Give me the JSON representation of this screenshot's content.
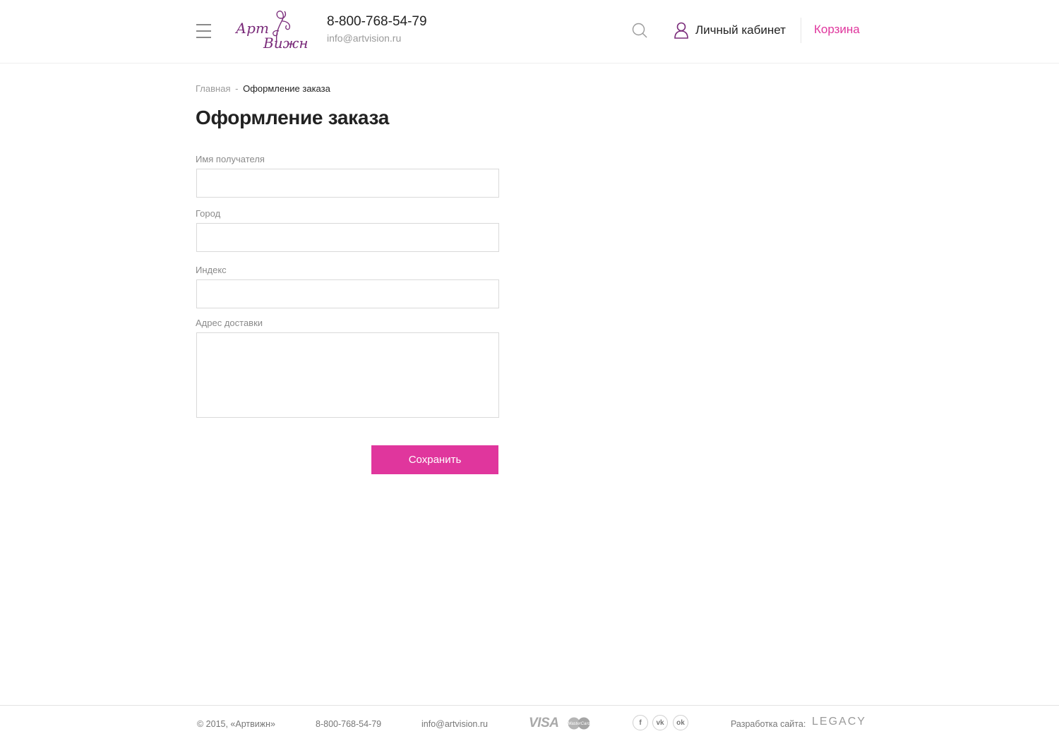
{
  "header": {
    "logo": {
      "line1": "Арт",
      "line2": "Вижн"
    },
    "phone": "8-800-768-54-79",
    "email": "info@artvision.ru",
    "cabinet_label": "Личный кабинет",
    "cart_label": "Корзина",
    "icons": {
      "menu": "hamburger-icon",
      "search": "search-icon",
      "user": "user-icon"
    }
  },
  "breadcrumb": {
    "home": "Главная",
    "separator": "-",
    "current": "Оформление заказа"
  },
  "page_title": "Оформление заказа",
  "form": {
    "fields": [
      {
        "label": "Имя получателя",
        "value": ""
      },
      {
        "label": "Город",
        "value": ""
      },
      {
        "label": "Индекс",
        "value": ""
      },
      {
        "label": "Адрес доставки",
        "value": ""
      }
    ],
    "save_label": "Сохранить"
  },
  "footer": {
    "copyright": "© 2015, «Артвижн»",
    "phone": "8-800-768-54-79",
    "email": "info@artvision.ru",
    "payment": {
      "visa": "VISA",
      "mastercard": "MasterCard"
    },
    "social": [
      "f",
      "vk",
      "ok"
    ],
    "dev_label": "Разработка сайта:",
    "dev_name": "LEGACY"
  },
  "colors": {
    "accent": "#e0369d",
    "logo": "#7a2b7a",
    "muted_text": "#9a9a9a",
    "border": "#d9d9d9"
  }
}
